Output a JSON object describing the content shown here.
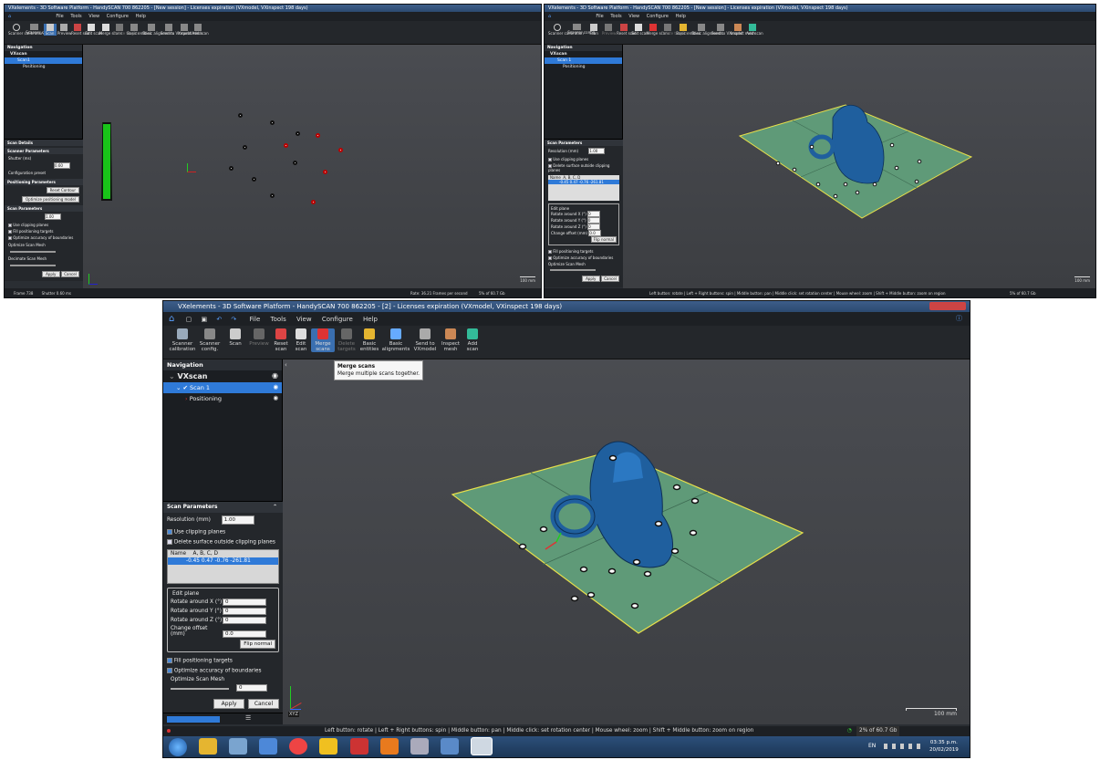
{
  "left_window": {
    "title": "VXelements - 3D Software Platform - HandySCAN 700 862205 - [New session] - Licenses expiration (VXmodel, VXinspect 198 days)",
    "menu": [
      "File",
      "Tools",
      "View",
      "Configure",
      "Help"
    ],
    "toolbar": [
      "Scanner calibration",
      "Scanner config.",
      "Scan",
      "Preview",
      "Reset scan",
      "Edit scan",
      "Merge scans",
      "Delete targets",
      "Basic entities",
      "Basic alignments",
      "Send to VXmodel",
      "Inspect mesh",
      "Add scan"
    ],
    "nav_title": "Navigation",
    "tree": {
      "root": "VXscan",
      "scan": "Scan1",
      "child": "Positioning"
    },
    "scan_details": "Scan Details",
    "scanner_params": "Scanner Parameters",
    "shutter_label": "Shutter (ms)",
    "shutter_value": "0.60",
    "config_preset_label": "Configuration preset",
    "positioning_params": "Positioning Parameters",
    "reset_contour": "Reset Contour",
    "optimize_positioning": "Optimize positioning model",
    "scan_params": "Scan Parameters",
    "resolution_value": "1.00",
    "checks": [
      "Use clipping planes",
      "Fill positioning targets",
      "Optimize accuracy of boundaries"
    ],
    "optimize_mesh": "Optimize Scan Mesh",
    "decimate_mesh": "Decimate Scan Mesh",
    "apply": "Apply",
    "cancel": "Cancel",
    "status_frame": "Frame 738",
    "status_shutter": "Shutter 0.60 ms",
    "status_rate": "Rate: 36.21 Frames per second",
    "status_mem": "5% of 60.7 Gb",
    "scale": "100 mm"
  },
  "right_window": {
    "title": "VXelements - 3D Software Platform - HandySCAN 700 862205 - [New session] - Licenses expiration (VXmodel, VXinspect 198 days)",
    "menu": [
      "File",
      "Tools",
      "View",
      "Configure",
      "Help"
    ],
    "status": "Left button: rotate | Left + Right buttons: spin | Middle button: pan | Middle click: set rotation center | Mouse wheel: zoom | Shift + Middle button: zoom on region",
    "status_mem": "5% of 60.7 Gb",
    "scale": "100 mm"
  },
  "main_window": {
    "title": "VXelements - 3D Software Platform - HandySCAN 700 862205 - [2] - Licenses expiration (VXmodel, VXinspect 198 days)",
    "menu": [
      "File",
      "Tools",
      "View",
      "Configure",
      "Help"
    ],
    "toolbar": [
      {
        "label": "Scanner\ncalibration",
        "icon": "calibration-icon",
        "dim": false
      },
      {
        "label": "Scanner\nconfig.",
        "icon": "scanner-config-icon",
        "dim": false
      },
      {
        "label": "Scan",
        "icon": "scan-icon",
        "dim": false
      },
      {
        "label": "Preview",
        "icon": "preview-icon",
        "dim": true
      },
      {
        "label": "Reset\nscan",
        "icon": "reset-scan-icon",
        "dim": false
      },
      {
        "label": "Edit\nscan",
        "icon": "edit-scan-icon",
        "dim": false
      },
      {
        "label": "Merge\nscans",
        "icon": "merge-scans-icon",
        "dim": false
      },
      {
        "label": "Delete\ntargets",
        "icon": "delete-targets-icon",
        "dim": true
      },
      {
        "label": "Basic\nentities",
        "icon": "basic-entities-icon",
        "dim": false
      },
      {
        "label": "Basic\nalignments",
        "icon": "basic-alignments-icon",
        "dim": false
      },
      {
        "label": "Send to\nVXmodel",
        "icon": "send-vxmodel-icon",
        "dim": false
      },
      {
        "label": "Inspect\nmesh",
        "icon": "inspect-mesh-icon",
        "dim": false
      },
      {
        "label": "Add\nscan",
        "icon": "add-scan-icon",
        "dim": false
      }
    ],
    "nav_title": "Navigation",
    "tree": {
      "root": "VXscan",
      "scan": "Scan 1",
      "child": "Positioning"
    },
    "tooltip_title": "Merge scans",
    "tooltip_body": "Merge multiple scans together.",
    "panel_title": "Scan Parameters",
    "resolution_label": "Resolution (mm)",
    "resolution_value": "1.00",
    "use_clipping": "Use clipping planes",
    "delete_surface": "Delete surface outside clipping planes",
    "table_header_name": "Name",
    "table_header_abcd": "A, B, C, D",
    "table_row": "-0.45  0.47  -0.76  -261.81",
    "edit_plane": "Edit plane",
    "rot_x_label": "Rotate around X (°)",
    "rot_x": "0",
    "rot_y_label": "Rotate around Y (°)",
    "rot_y": "0",
    "rot_z_label": "Rotate around Z (°)",
    "rot_z": "0",
    "offset_label": "Change offset (mm)",
    "offset": "0.0",
    "flip_normal": "Flip normal",
    "fill_targets": "Fill positioning targets",
    "optimize_boundaries": "Optimize accuracy of boundaries",
    "optimize_mesh": "Optimize Scan Mesh",
    "mesh_value": "0",
    "apply": "Apply",
    "cancel": "Cancel",
    "status_hint": "Left button: rotate | Left + Right buttons: spin | Middle button: pan | Middle click: set rotation center | Mouse wheel: zoom | Shift + Middle button: zoom on region",
    "status_mem": "2% of 60.7 Gb",
    "scale": "100 mm",
    "axes_label": "XYZ",
    "taskbar_lang": "EN",
    "clock_time": "03:35 p.m.",
    "clock_date": "20/02/2019"
  },
  "colors": {
    "plate": "#5f9a78",
    "part": "#1f5f9e",
    "accent": "#2f7ad8"
  }
}
